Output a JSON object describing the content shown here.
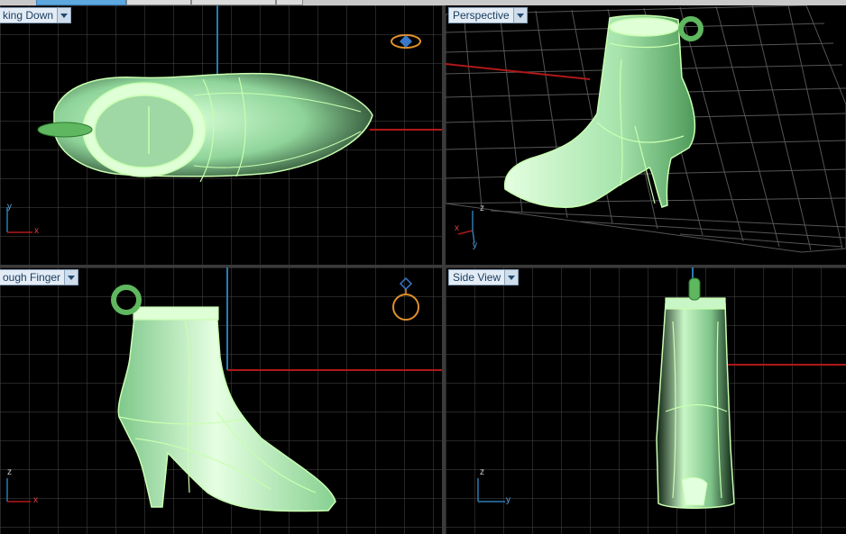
{
  "viewports": {
    "top_left": {
      "title": "king Down"
    },
    "top_right": {
      "title": "Perspective"
    },
    "bottom_left": {
      "title": "ough Finger"
    },
    "bottom_right": {
      "title": "Side View"
    }
  },
  "axes": {
    "top_left": {
      "a": "y",
      "b": "x"
    },
    "top_right": {
      "a": "z",
      "b": "x",
      "c": "y"
    },
    "bottom_left": {
      "a": "z",
      "b": "x"
    },
    "bottom_right": {
      "a": "z",
      "b": "y"
    }
  },
  "icons": {
    "top_left": "ring-gizmo-icon",
    "bottom_left": "ring-gizmo-icon"
  },
  "colors": {
    "grid": "#4a4a4a",
    "axis_red": "#b01818",
    "axis_blue": "#2a7bb0",
    "model_fill": "#9fe0a8",
    "model_edge": "#c8ffb0",
    "gizmo": "#e0902a"
  }
}
